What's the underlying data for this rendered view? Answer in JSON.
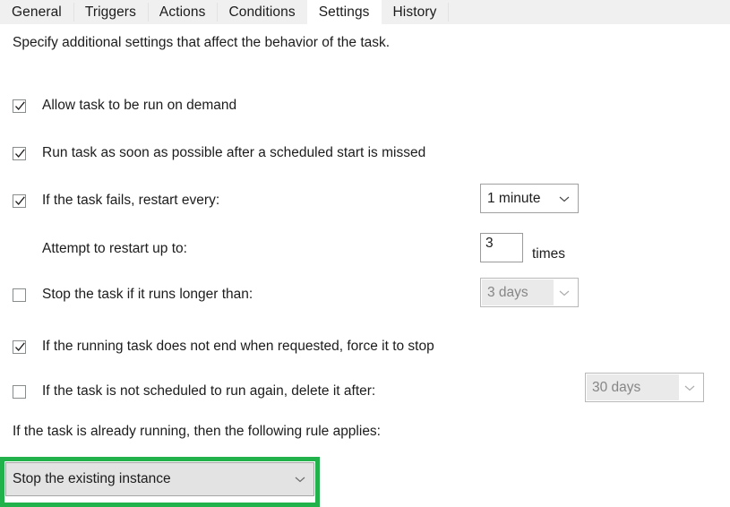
{
  "tabs": [
    {
      "label": "General",
      "selected": false
    },
    {
      "label": "Triggers",
      "selected": false
    },
    {
      "label": "Actions",
      "selected": false
    },
    {
      "label": "Conditions",
      "selected": false
    },
    {
      "label": "Settings",
      "selected": true
    },
    {
      "label": "History",
      "selected": false
    }
  ],
  "description": "Specify additional settings that affect the behavior of the task.",
  "settings": {
    "allow_on_demand": {
      "label": "Allow task to be run on demand",
      "checked": "✓"
    },
    "run_asap": {
      "label": "Run task as soon as possible after a scheduled start is missed",
      "checked": "✓"
    },
    "restart_on_fail": {
      "label": "If the task fails, restart every:",
      "checked": "✓",
      "interval_value": "1 minute"
    },
    "restart_attempts": {
      "label": "Attempt to restart up to:",
      "value": "3",
      "suffix": "times"
    },
    "stop_if_longer": {
      "label": "Stop the task if it runs longer than:",
      "checked": "",
      "duration_value": "3 days",
      "disabled": true
    },
    "force_stop": {
      "label": "If the running task does not end when requested, force it to stop",
      "checked": "✓"
    },
    "delete_after": {
      "label": "If the task is not scheduled to run again, delete it after:",
      "checked": "",
      "duration_value": "30 days",
      "disabled": true
    },
    "already_running": {
      "label": "If the task is already running, then the following rule applies:",
      "rule_value": "Stop the existing instance"
    }
  },
  "colors": {
    "highlight": "#22b24c",
    "tabstrip_bg": "#f0f0f0",
    "text": "#1c1c1c",
    "disabled_text": "#868686"
  },
  "icons": {
    "chevron": "chevron-down-icon",
    "check": "check-icon"
  }
}
